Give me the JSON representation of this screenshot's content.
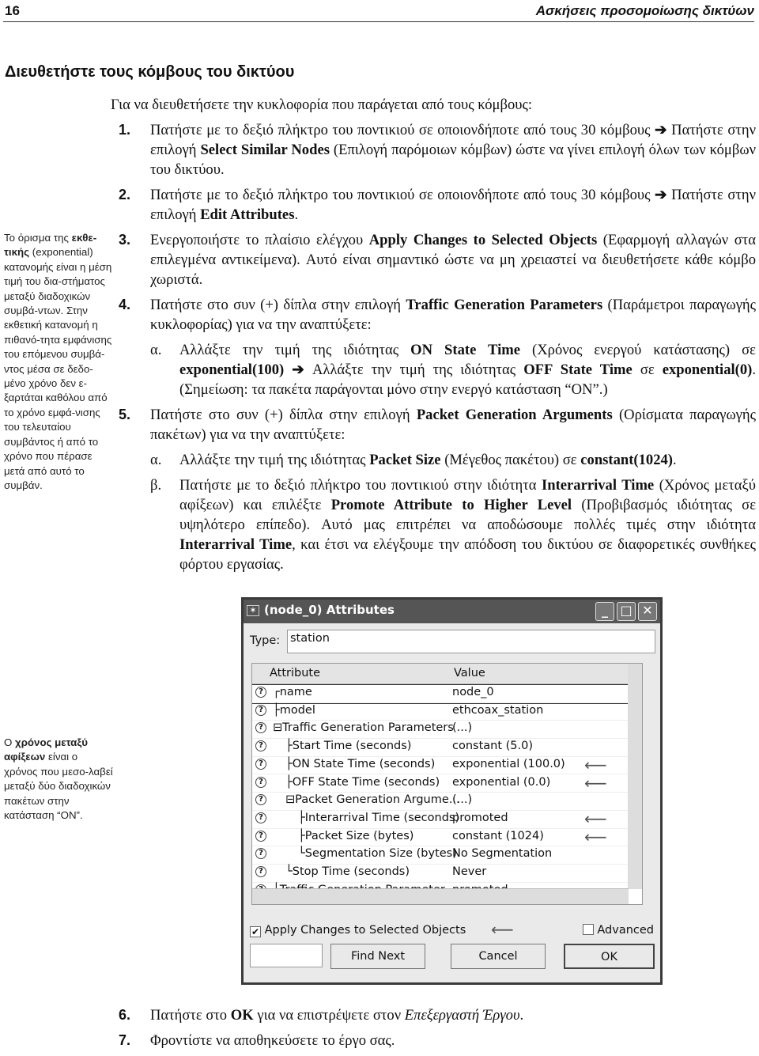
{
  "header": {
    "page_number": "16",
    "running_title": "Ασκήσεις προσομοίωσης δικτύων"
  },
  "title": "Διευθετήστε τους κόμβους του δικτύου",
  "sidenote1": [
    {
      "text": "Το όρισμα της "
    },
    {
      "text": "εκθε-τικής",
      "bold": true
    },
    {
      "text": " (exponential) κατανομής είναι η μέση τιμή του δια-στήματος μεταξύ διαδοχικών συμβά-ντων. Στην εκθετική κατανομή η πιθανό-τητα εμφάνισης του επόμενου συμβά-ντος μέσα σε δεδο-μένο χρόνο δεν ε-ξαρτάται καθόλου από το χρόνο εμφά-νισης του τελευταίου συμβάντος ή από το χρόνο που πέρασε μετά από αυτό το συμβάν."
    }
  ],
  "sidenote2": [
    {
      "text": "Ο "
    },
    {
      "text": "χρόνος μεταξύ αφίξεων",
      "bold": true
    },
    {
      "text": " είναι ο χρόνος που μεσο-λαβεί μεταξύ δύο διαδοχικών πακέτων στην κατάσταση “ON”."
    }
  ],
  "intro": "Για να διευθετήσετε την κυκλοφορία που παράγεται από τους κόμβους:",
  "steps": [
    {
      "num": "1.",
      "parts": [
        {
          "text": "Πατήστε με το δεξιό πλήκτρο του ποντικιού σε οποιονδήποτε από τους 30 κόμβους "
        },
        {
          "text": "➔",
          "bold": true
        },
        {
          "text": " Πατήστε στην επιλογή "
        },
        {
          "text": "Select Similar Nodes",
          "bold": true
        },
        {
          "text": " (Επιλογή παρόμοιων κόμβων) ώστε να γίνει επιλογή όλων των κόμβων του δικτύου."
        }
      ]
    },
    {
      "num": "2.",
      "parts": [
        {
          "text": "Πατήστε με το δεξιό πλήκτρο του ποντικιού σε οποιονδήποτε από τους 30 κόμβους "
        },
        {
          "text": "➔",
          "bold": true
        },
        {
          "text": " Πατήστε στην επιλογή "
        },
        {
          "text": "Edit Attributes",
          "bold": true
        },
        {
          "text": "."
        }
      ]
    },
    {
      "num": "3.",
      "parts": [
        {
          "text": "Ενεργοποιήστε το πλαίσιο ελέγχου "
        },
        {
          "text": "Apply Changes to Selected Objects",
          "bold": true
        },
        {
          "text": " (Εφαρμογή αλλαγών στα επιλεγμένα αντικείμενα). Αυτό είναι σημαντικό ώστε να μη χρειαστεί να διευθετήσετε κάθε κόμβο χωριστά."
        }
      ]
    },
    {
      "num": "4.",
      "parts": [
        {
          "text": "Πατήστε στο συν (+) δίπλα στην επιλογή "
        },
        {
          "text": "Traffic Generation Parameters",
          "bold": true
        },
        {
          "text": " (Παράμετροι παραγωγής κυκλοφορίας) για να την αναπτύξετε:"
        }
      ],
      "subs": [
        {
          "num": "α.",
          "parts": [
            {
              "text": "Αλλάξτε την τιμή της ιδιότητας "
            },
            {
              "text": "ON State Time",
              "bold": true
            },
            {
              "text": " (Χρόνος ενεργού κατάστασης) σε "
            },
            {
              "text": "exponential(100) ➔",
              "bold": true
            },
            {
              "text": " Αλλάξτε την τιμή της ιδιότητας "
            },
            {
              "text": "OFF State Time",
              "bold": true
            },
            {
              "text": " σε "
            },
            {
              "text": "exponential(0)",
              "bold": true
            },
            {
              "text": ". (Σημείωση: τα πακέτα παράγονται μόνο στην ενεργό κατάσταση “ON”.)"
            }
          ]
        }
      ]
    },
    {
      "num": "5.",
      "parts": [
        {
          "text": "Πατήστε στο συν (+) δίπλα στην επιλογή "
        },
        {
          "text": "Packet Generation Arguments",
          "bold": true
        },
        {
          "text": " (Ορίσματα παραγωγής πακέτων) για να την αναπτύξετε:"
        }
      ],
      "subs": [
        {
          "num": "α.",
          "parts": [
            {
              "text": "Αλλάξτε την τιμή της ιδιότητας "
            },
            {
              "text": "Packet Size",
              "bold": true
            },
            {
              "text": " (Μέγεθος πακέτου) σε "
            },
            {
              "text": "constant(1024)",
              "bold": true
            },
            {
              "text": "."
            }
          ]
        },
        {
          "num": "β.",
          "parts": [
            {
              "text": "Πατήστε με το δεξιό πλήκτρο του ποντικιού στην ιδιότητα "
            },
            {
              "text": "Interarrival Time",
              "bold": true
            },
            {
              "text": " (Χρόνος μεταξύ αφίξεων) και επιλέξτε "
            },
            {
              "text": "Promote Attribute to Higher Level",
              "bold": true
            },
            {
              "text": " (Προβιβασμός ιδιότητας σε υψηλότερο επίπεδο). Αυτό μας επιτρέπει να αποδώσουμε πολλές τιμές στην ιδιότητα "
            },
            {
              "text": "Interarrival Time",
              "bold": true
            },
            {
              "text": ", και έτσι να ελέγξουμε την απόδοση του δικτύου σε διαφορετικές συνθήκες φόρτου εργασίας."
            }
          ]
        }
      ]
    }
  ],
  "steps_after": [
    {
      "num": "6.",
      "parts": [
        {
          "text": "Πατήστε στο "
        },
        {
          "text": "OK",
          "bold": true
        },
        {
          "text": " για να επιστρέψετε στον "
        },
        {
          "text": "Επεξεργαστή Έργου",
          "italic": true
        },
        {
          "text": "."
        }
      ]
    },
    {
      "num": "7.",
      "parts": [
        {
          "text": "Φροντίστε να αποθηκεύσετε το έργο σας."
        }
      ]
    }
  ],
  "dialog": {
    "title": "(node_0) Attributes",
    "type_label": "Type:",
    "type_value": "station",
    "col_attribute": "Attribute",
    "col_value": "Value",
    "rows": [
      {
        "glyph": "┌",
        "attr": "name",
        "value": "node_0",
        "level": 0
      },
      {
        "glyph": "├",
        "attr": "model",
        "value": "ethcoax_station",
        "level": 0
      },
      {
        "glyph": "⊟",
        "attr": "Traffic Generation Parameters",
        "value": "(...)",
        "level": 0
      },
      {
        "glyph": "├",
        "attr": "Start Time (seconds)",
        "value": "constant (5.0)",
        "level": 1
      },
      {
        "glyph": "├",
        "attr": "ON State Time (seconds)",
        "value": "exponential (100.0)",
        "level": 1,
        "arrow": true
      },
      {
        "glyph": "├",
        "attr": "OFF State Time (seconds)",
        "value": "exponential (0.0)",
        "level": 1,
        "arrow": true
      },
      {
        "glyph": "⊟",
        "attr": "Packet Generation Argume...",
        "value": "(...)",
        "level": 1
      },
      {
        "glyph": "├",
        "attr": "Interarrival Time (seconds)",
        "value": "promoted",
        "level": 2,
        "arrow": true
      },
      {
        "glyph": "├",
        "attr": "Packet Size (bytes)",
        "value": "constant (1024)",
        "level": 2,
        "arrow": true
      },
      {
        "glyph": "└",
        "attr": "Segmentation Size (bytes)",
        "value": "No Segmentation",
        "level": 2
      },
      {
        "glyph": "└",
        "attr": "Stop Time (seconds)",
        "value": "Never",
        "level": 1
      },
      {
        "glyph": "└",
        "attr": "Traffic Generation Parameter...",
        "value": "promoted",
        "level": 0
      }
    ],
    "apply_label": "Apply Changes to Selected Objects",
    "apply_checked": true,
    "advanced_label": "Advanced",
    "advanced_checked": false,
    "find_next": "Find Next",
    "cancel": "Cancel",
    "ok": "OK"
  }
}
